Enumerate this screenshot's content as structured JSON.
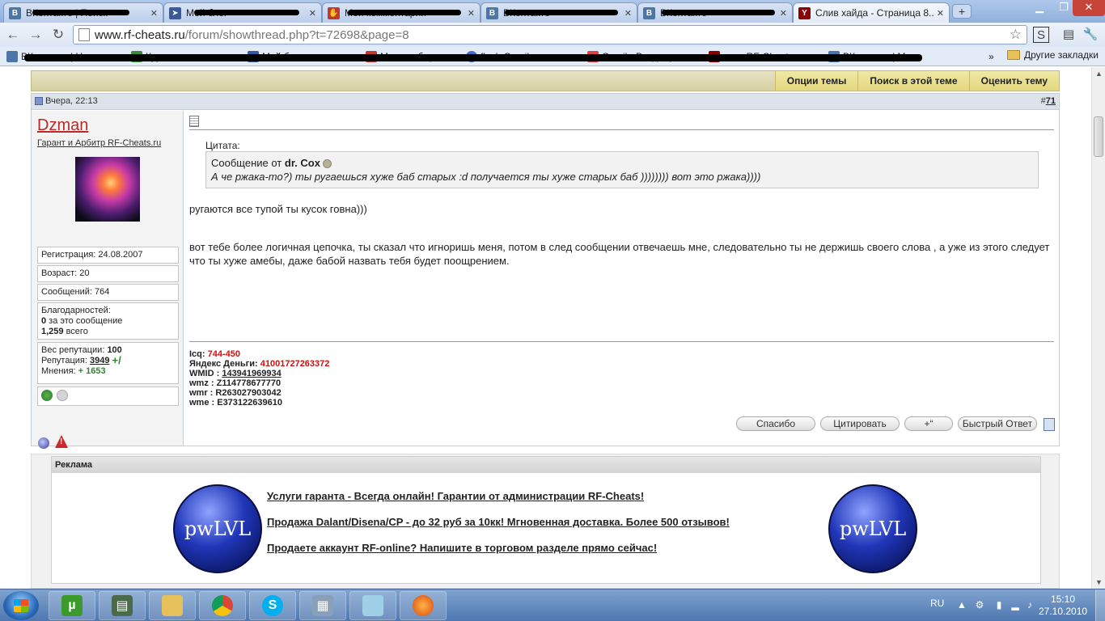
{
  "browser": {
    "tabs": [
      {
        "title": "ВКонтакте | Поиск",
        "favicon": "vk-icon"
      },
      {
        "title": "Мой блог",
        "favicon": "arrow-icon"
      },
      {
        "title": "Мои комментарии",
        "favicon": "hand-icon"
      },
      {
        "title": "ВКонтакте",
        "favicon": "vk-icon"
      },
      {
        "title": "ВКонтакте",
        "favicon": "vk-icon"
      },
      {
        "title": "Слив хайда - Страница 8...",
        "favicon": "rf-cheats-icon",
        "active": true
      }
    ],
    "new_tab_label": "+",
    "url_host": "www.rf-cheats.ru",
    "url_path": "/forum/showthread.php?t=72698&page=8",
    "bookmarks": [
      {
        "label": "ВКонтакте | Новости"
      },
      {
        "label": "Курс валют"
      },
      {
        "label": "Мой блог"
      },
      {
        "label": "Мои сообщения"
      },
      {
        "label": "flash Gmail"
      },
      {
        "label": "Gmail - Входящие"
      },
      {
        "label": "www.RF-Cheats.ru"
      },
      {
        "label": "ВКонтакте | Моя"
      }
    ],
    "bookmarks_overflow": "»",
    "other_bookmarks": "Другие закладки"
  },
  "thread_tools": {
    "options": "Опции темы",
    "search": "Поиск в этой теме",
    "rate": "Оценить тему"
  },
  "post": {
    "date": "Вчера, 22:13",
    "number_prefix": "#",
    "number": "71",
    "user": {
      "name": "Dzman",
      "title": "Гарант и Арбитр RF-Cheats.ru",
      "registration": "Регистрация: 24.08.2007",
      "age": "Возраст: 20",
      "posts": "Сообщений: 764",
      "thanks_label": "Благодарностей:",
      "thanks_this_count": "0",
      "thanks_this_text": " за это сообщение",
      "thanks_total_count": "1,259",
      "thanks_total_text": " всего",
      "rep_weight_label": "Вес репутации: ",
      "rep_weight": "100",
      "rep_label": "Репутация: ",
      "rep": "3949",
      "opinions_label": "Мнения: ",
      "opinions": "+ 1653"
    },
    "quote_label": "Цитата:",
    "quote_from": "Сообщение от ",
    "quote_author": "dr. Cox",
    "quote_text": "А че ржака-то?) ты ругаешься хуже баб старых :d получается ты хуже старых баб )))))))) вот это ржака))))",
    "message_1": "ругаются все тупой ты кусок говна)))",
    "message_2": "вот тебе более логичная цепочка, ты сказал что игноришь меня, потом в след сообщении отвечаешь мне, следовательно ты не держишь своего слова , а уже из этого следует что ты хуже амебы, даже бабой назвать тебя будет поощрением.",
    "signature": {
      "icq_label": "Icq: ",
      "icq": "744-450",
      "yandex_label": "Яндекс Деньги: ",
      "yandex": "41001727263372",
      "wmid_label": "WMID : ",
      "wmid": "143941969934",
      "wmz": "wmz : Z114778677770",
      "wmr": "wmr : R263027903042",
      "wme": "wme : E373122639610"
    },
    "buttons": {
      "thanks": "Спасибо",
      "quote": "Цитировать",
      "multiquote": "+“",
      "quick_reply": "Быстрый Ответ"
    }
  },
  "ads": {
    "header": "Реклама",
    "logo_text": "pwLVL",
    "links": [
      "Услуги гаранта - Всегда онлайн! Гарантии от администрации RF-Cheats!",
      "Продажа Dalant/Disena/CP - до 32 руб за 10кк! Мгновенная доставка. Более 500 отзывов!",
      "Продаете аккаунт RF-online? Напишите в торговом разделе прямо сейчас!"
    ]
  },
  "taskbar": {
    "lang": "RU",
    "time": "15:10",
    "date": "27.10.2010"
  }
}
